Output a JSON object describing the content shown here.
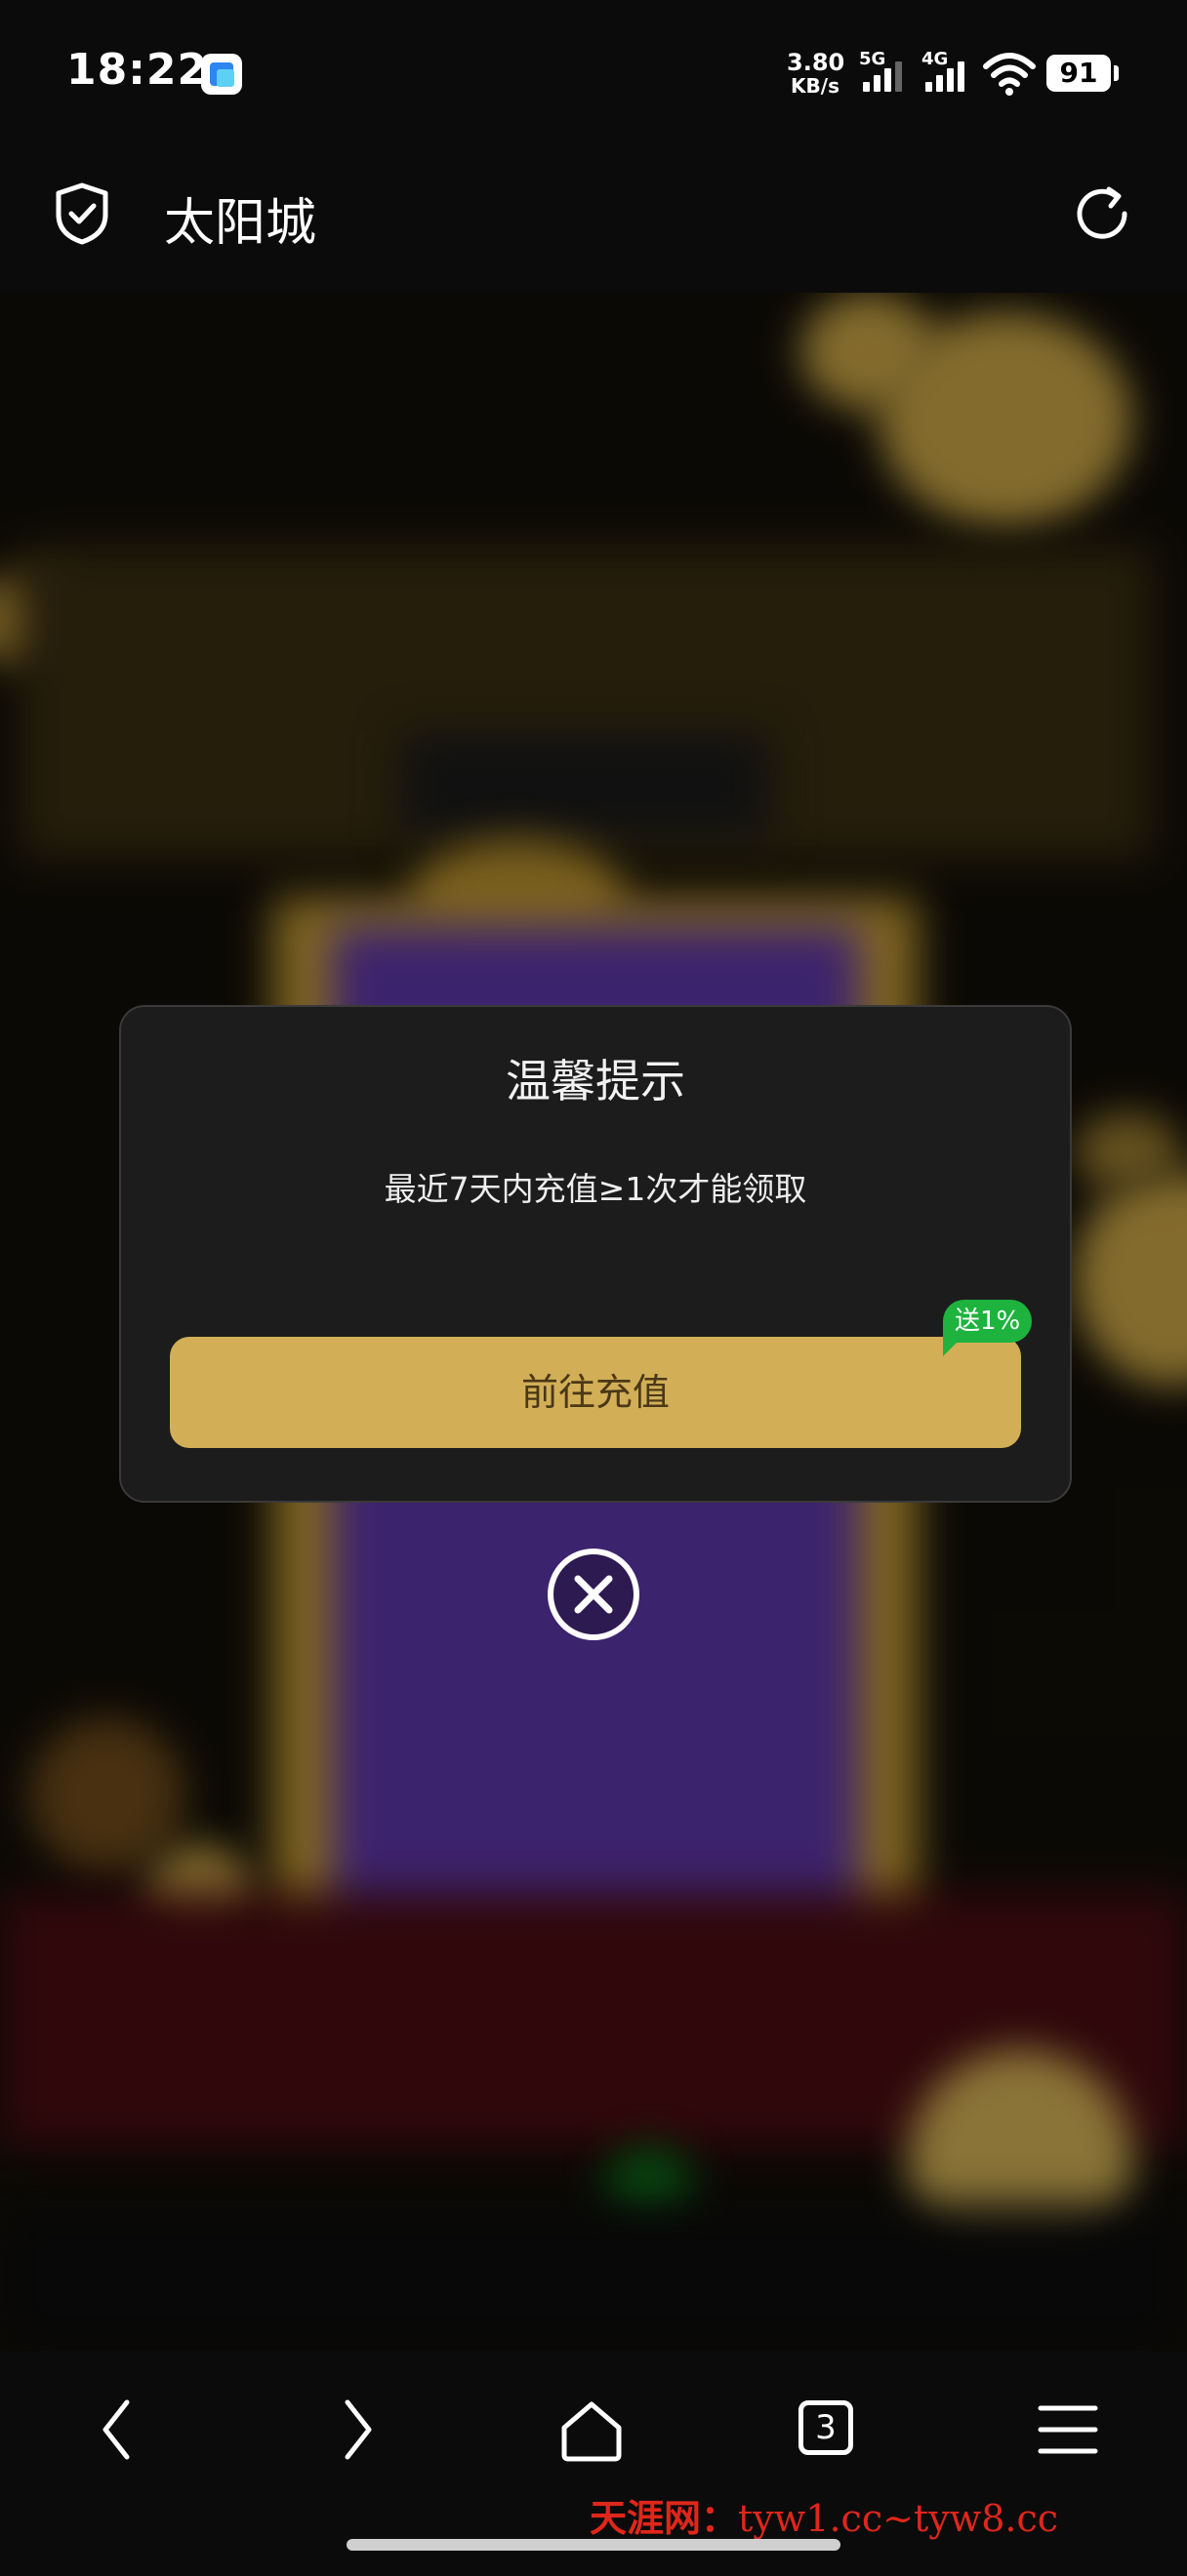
{
  "status_bar": {
    "time": "18:22",
    "net_speed_value": "3.80",
    "net_speed_unit": "KB/s",
    "sim1_label": "5G",
    "sim2_label": "4G",
    "battery": "91"
  },
  "header": {
    "title": "太阳城"
  },
  "dialog": {
    "title": "温馨提示",
    "message": "最近7天内充值≥1次才能领取",
    "button_label": "前往充值",
    "promo_badge": "送1%"
  },
  "bottom_nav": {
    "tabs_count": "3"
  },
  "watermark": {
    "name": "天涯网：",
    "domains": "tyw1.cc~tyw8.cc"
  },
  "colors": {
    "accent_gold": "#d2af57",
    "promo_green": "#1db33e",
    "dialog_bg": "#1c1c1c"
  }
}
